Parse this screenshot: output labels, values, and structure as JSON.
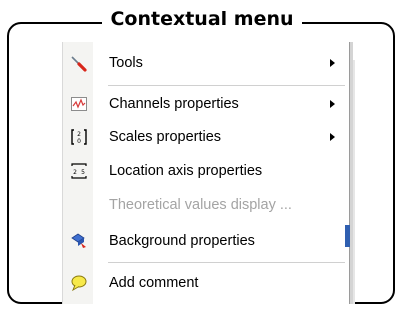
{
  "title": "Contextual menu",
  "menu": {
    "items": [
      {
        "label": "Tools",
        "icon": "tools-icon",
        "submenu": true,
        "enabled": true
      },
      {
        "label": "Channels properties",
        "icon": "channels-properties-icon",
        "submenu": true,
        "enabled": true
      },
      {
        "label": "Scales properties",
        "icon": "scales-properties-icon",
        "submenu": true,
        "enabled": true
      },
      {
        "label": "Location axis properties",
        "icon": "location-axis-icon",
        "submenu": false,
        "enabled": true
      },
      {
        "label": "Theoretical values display ...",
        "icon": "",
        "submenu": false,
        "enabled": false
      },
      {
        "label": "Background properties",
        "icon": "background-properties-icon",
        "submenu": false,
        "enabled": true
      },
      {
        "label": "Add comment",
        "icon": "comment-bubble-icon",
        "submenu": false,
        "enabled": true
      }
    ]
  },
  "colors": {
    "disabled_text": "#a4a4a4",
    "gutter": "#f4f4f2"
  }
}
